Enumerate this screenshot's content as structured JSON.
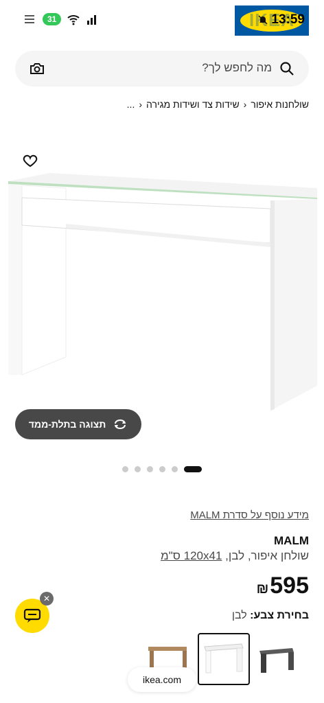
{
  "status_bar": {
    "notification_count": "31",
    "time": "13:59",
    "logo_text": "IKEA"
  },
  "search": {
    "placeholder": "מה לחפש לך?"
  },
  "breadcrumb": {
    "items": [
      "...",
      "שידות צד ושידות מגירה",
      "שולחנות איפור"
    ]
  },
  "gallery": {
    "view_3d_label": "תצוגה בתלת-ממד",
    "dots_total": 6,
    "active_dot": 1
  },
  "product": {
    "series_link": "מידע נוסף על סדרת MALM",
    "name": "MALM",
    "description_prefix": "שולחן איפור, לבן, ",
    "description_size": "120x41 ס\"מ",
    "price": "595",
    "currency": "₪",
    "color_label": "בחירת צבע:",
    "color_value": "לבן"
  },
  "variants": [
    {
      "name": "black-brown",
      "color": "#4a4a4a"
    },
    {
      "name": "white",
      "color": "#f7f7f7",
      "selected": true
    },
    {
      "name": "oak-veneer",
      "color": "#b08a5e"
    }
  ],
  "browser": {
    "url": "ikea.com"
  },
  "colors": {
    "accent_yellow": "#ffdb00",
    "ikea_blue": "#0058a3",
    "dark_button": "#484848"
  }
}
